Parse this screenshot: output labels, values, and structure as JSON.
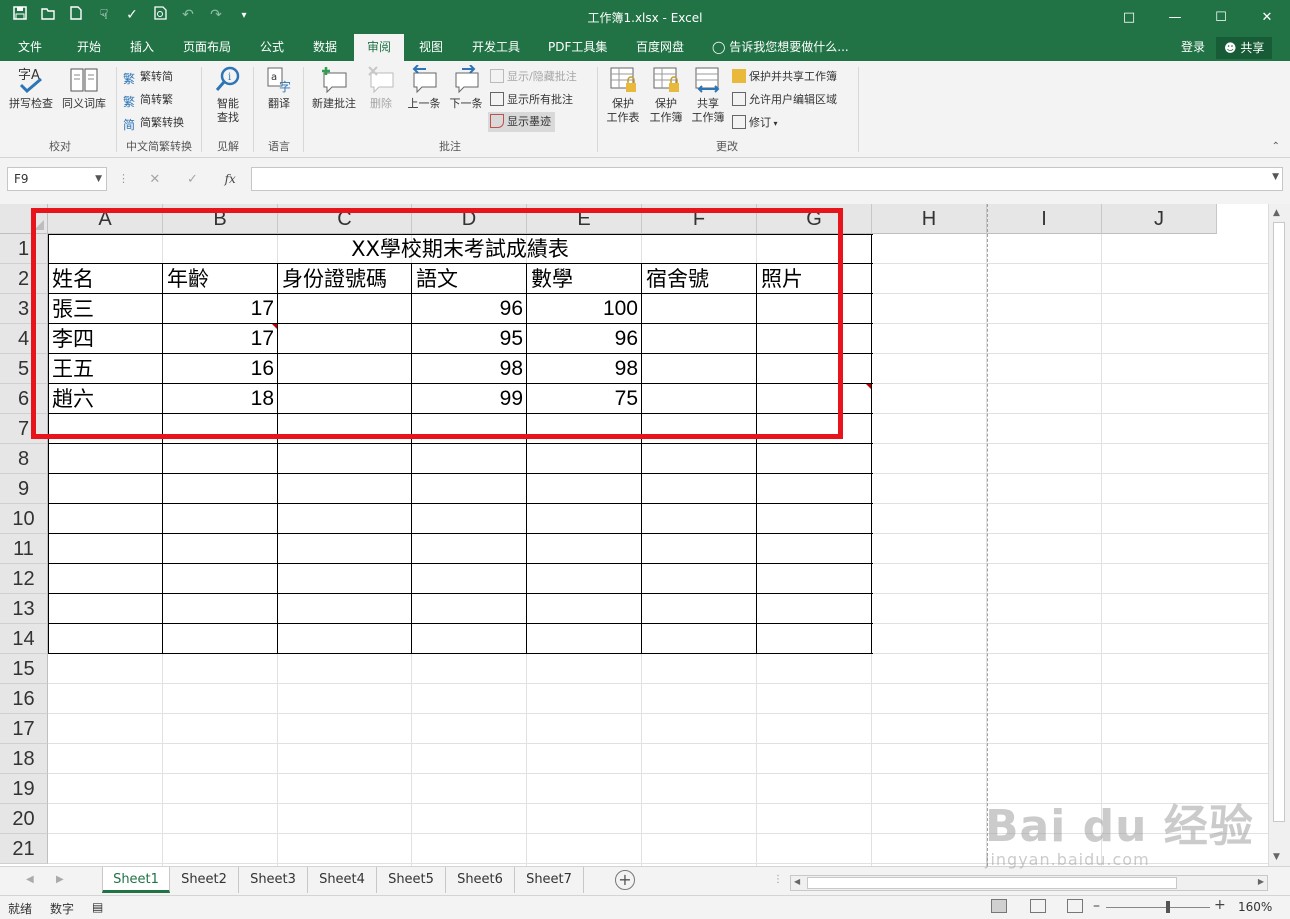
{
  "titlebar": {
    "title": "工作簿1.xlsx - Excel",
    "qat": [
      "save-icon",
      "open-icon",
      "new-icon",
      "touch-mode-icon",
      "spelling-icon",
      "print-preview-icon",
      "undo-icon",
      "redo-icon",
      "customize-qat-icon"
    ]
  },
  "ribbon_tabs": [
    "文件",
    "开始",
    "插入",
    "页面布局",
    "公式",
    "数据",
    "审阅",
    "视图",
    "开发工具",
    "PDF工具集",
    "百度网盘"
  ],
  "active_tab": "审阅",
  "tell_me": "告诉我您想要做什么...",
  "login": "登录",
  "share": "共享",
  "ribbon": {
    "groups": {
      "proofing": "校对",
      "chinese_conversion": "中文简繁转换",
      "insights": "见解",
      "language": "语言",
      "comments": "批注",
      "changes": "更改"
    },
    "buttons": {
      "spell_check": "拼写检查",
      "thesaurus": "同义词库",
      "trad_to_simp": "繁转简",
      "simp_to_trad": "简转繁",
      "convert": "简繁转换",
      "smart_lookup_1": "智能",
      "smart_lookup_2": "查找",
      "translate": "翻译",
      "new_comment": "新建批注",
      "delete": "删除",
      "previous": "上一条",
      "next": "下一条",
      "show_hide_comment": "显示/隐藏批注",
      "show_all_comments": "显示所有批注",
      "show_ink": "显示墨迹",
      "protect_sheet_1": "保护",
      "protect_sheet_2": "工作表",
      "protect_workbook_1": "保护",
      "protect_workbook_2": "工作簿",
      "share_workbook_1": "共享",
      "share_workbook_2": "工作簿",
      "protect_share": "保护并共享工作簿",
      "allow_edit_ranges": "允许用户编辑区域",
      "track_changes": "修订"
    }
  },
  "formula_bar": {
    "name_box": "F9",
    "fx": "fx",
    "value": ""
  },
  "columns": [
    "A",
    "B",
    "C",
    "D",
    "E",
    "F",
    "G",
    "H",
    "I",
    "J"
  ],
  "rows": [
    "1",
    "2",
    "3",
    "4",
    "5",
    "6",
    "7",
    "8",
    "9",
    "10",
    "11",
    "12",
    "13",
    "14",
    "15",
    "16",
    "17",
    "18",
    "19",
    "20",
    "21"
  ],
  "sheet": {
    "title": "XX學校期末考試成績表",
    "headers": [
      "姓名",
      "年齡",
      "身份證號碼",
      "語文",
      "數學",
      "宿舍號",
      "照片"
    ],
    "records": [
      {
        "name": "張三",
        "age": "17",
        "chinese": "96",
        "math": "100"
      },
      {
        "name": "李四",
        "age": "17",
        "chinese": "95",
        "math": "96"
      },
      {
        "name": "王五",
        "age": "16",
        "chinese": "98",
        "math": "98"
      },
      {
        "name": "趙六",
        "age": "18",
        "chinese": "99",
        "math": "75"
      }
    ]
  },
  "sheet_tabs": [
    "Sheet1",
    "Sheet2",
    "Sheet3",
    "Sheet4",
    "Sheet5",
    "Sheet6",
    "Sheet7"
  ],
  "active_sheet": "Sheet1",
  "status": {
    "ready": "就绪",
    "mode": "数字",
    "zoom": "160%",
    "zoom_fraction": 0.6
  },
  "watermark": {
    "brand": "Bai du 经验",
    "url": "jingyan.baidu.com"
  },
  "colors": {
    "excel_green": "#217346",
    "highlight_red": "#e8141c",
    "comment_marker": "#c00000"
  }
}
